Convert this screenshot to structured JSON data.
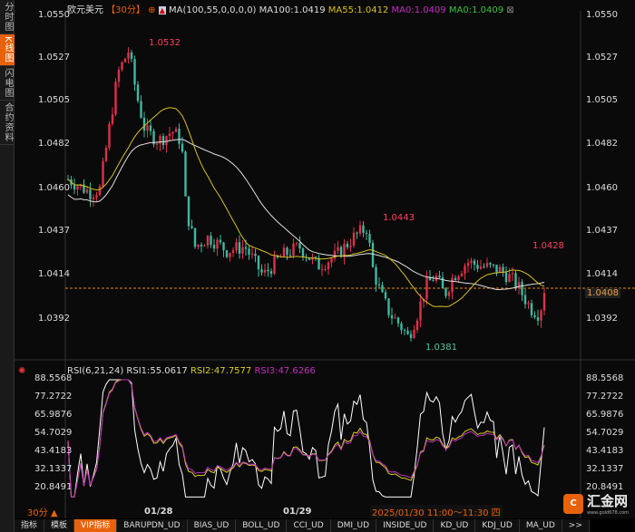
{
  "sidebar": {
    "tabs": [
      "分时图",
      "K线图",
      "闪电图",
      "合约资料"
    ]
  },
  "header": {
    "symbol": "欧元美元",
    "period": "【30分】",
    "ma_params": "MA(100,55,0,0,0,0)",
    "ma100": "MA100:1.0419",
    "ma55": "MA55:1.0412",
    "ma0a": "MA0:1.0409",
    "ma0b": "MA0:1.0409",
    "close": "⊠"
  },
  "price_axis": [
    "1.0550",
    "1.0527",
    "1.0505",
    "1.0482",
    "1.0460",
    "1.0437",
    "1.0414",
    "1.0392"
  ],
  "current_price": "1.0408",
  "annotations": {
    "high": "1.0532",
    "mid_high": "1.0443",
    "right_high": "1.0428",
    "low": "1.0381"
  },
  "rsi": {
    "label": "RSI(6,21,24)",
    "rsi1": "RSI1:55.0617",
    "rsi2": "RSI2:47.7577",
    "rsi3": "RSI3:47.6266",
    "axis": [
      "88.5568",
      "77.2722",
      "65.9876",
      "54.7029",
      "43.4183",
      "32.1337",
      "20.8491"
    ]
  },
  "footer": {
    "period": "30分 ▲",
    "dates": [
      "01/28",
      "01/29"
    ],
    "cursor_time": "2025/01/30 11:00～11:30 四"
  },
  "logo": {
    "name": "汇金网",
    "url": "www.gold678.com"
  },
  "bottom_tabs": [
    "指标",
    "模板",
    "VIP指标",
    "BARUPDN_UD",
    "BIAS_UD",
    "BOLL_UD",
    "CCI_UD",
    "DMI_UD",
    "INSIDE_UD",
    "KD_UD",
    "KDJ_UD",
    "MA_UD",
    ">>"
  ],
  "colors": {
    "up": "#e0304a",
    "down": "#3fb8a0",
    "ma100": "#e0e0e0",
    "ma55": "#d8c020",
    "rsi1": "#ffffff",
    "rsi2": "#d8d020",
    "rsi3": "#c030c0",
    "accent": "#e8620c"
  },
  "price_path": [
    [
      75,
      1.0465
    ],
    [
      100,
      1.0458
    ],
    [
      110,
      1.046
    ],
    [
      120,
      1.049
    ],
    [
      130,
      1.052
    ],
    [
      142,
      1.0532
    ],
    [
      150,
      1.051
    ],
    [
      160,
      1.049
    ],
    [
      175,
      1.0485
    ],
    [
      190,
      1.049
    ],
    [
      200,
      1.0485
    ],
    [
      205,
      1.045
    ],
    [
      215,
      1.043
    ],
    [
      230,
      1.0435
    ],
    [
      250,
      1.0428
    ],
    [
      270,
      1.043
    ],
    [
      290,
      1.0415
    ],
    [
      310,
      1.0425
    ],
    [
      330,
      1.043
    ],
    [
      350,
      1.042
    ],
    [
      370,
      1.0425
    ],
    [
      390,
      1.0435
    ],
    [
      405,
      1.044
    ],
    [
      410,
      1.042
    ],
    [
      420,
      1.0405
    ],
    [
      430,
      1.0395
    ],
    [
      440,
      1.039
    ],
    [
      450,
      1.0383
    ],
    [
      460,
      1.0395
    ],
    [
      470,
      1.041
    ],
    [
      480,
      1.0415
    ],
    [
      490,
      1.0405
    ],
    [
      500,
      1.0415
    ],
    [
      515,
      1.0422
    ],
    [
      530,
      1.042
    ],
    [
      550,
      1.0418
    ],
    [
      560,
      1.0415
    ],
    [
      570,
      1.041
    ],
    [
      585,
      1.0398
    ],
    [
      595,
      1.0395
    ],
    [
      600,
      1.0408
    ]
  ]
}
